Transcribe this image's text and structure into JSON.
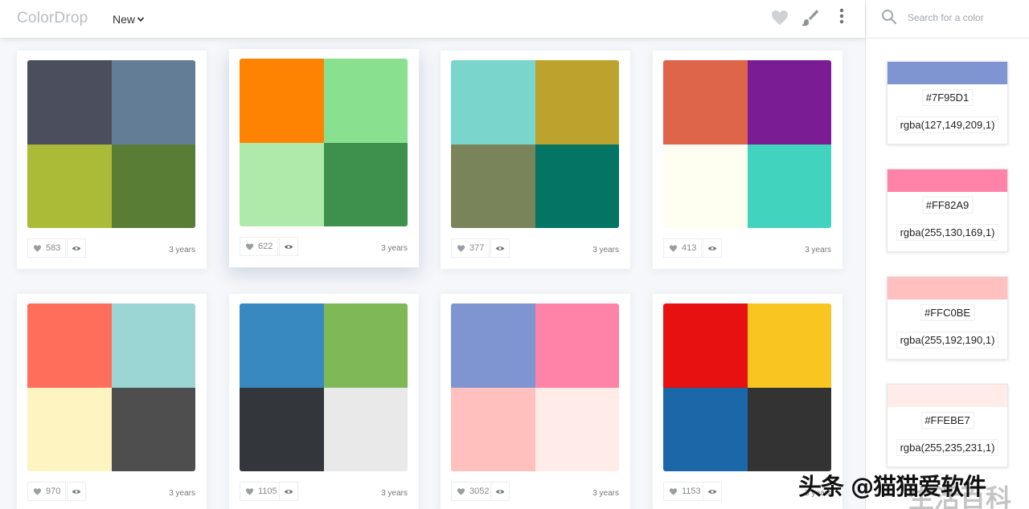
{
  "header": {
    "logo": "ColorDrop",
    "menu_new": "New"
  },
  "search": {
    "placeholder": "Search for a color"
  },
  "palettes": [
    {
      "colors": [
        "#4b4e5c",
        "#647d96",
        "#abbb37",
        "#5a7d35"
      ],
      "likes": "583",
      "age": "3 years"
    },
    {
      "colors": [
        "#ff8303",
        "#89e08f",
        "#b0eaaa",
        "#3e914d"
      ],
      "likes": "622",
      "age": "3 years"
    },
    {
      "colors": [
        "#7ad5cc",
        "#bca32d",
        "#7a845a",
        "#047465"
      ],
      "likes": "377",
      "age": "3 years"
    },
    {
      "colors": [
        "#de644a",
        "#7a1d94",
        "#fefef1",
        "#42d3bf"
      ],
      "likes": "413",
      "age": "3 years"
    },
    {
      "colors": [
        "#ff6e5a",
        "#9bd6d4",
        "#fef4c2",
        "#4e4e4f"
      ],
      "likes": "970",
      "age": "3 years"
    },
    {
      "colors": [
        "#3789c0",
        "#7fb957",
        "#33363b",
        "#e9e9e9"
      ],
      "likes": "1105",
      "age": "3 years"
    },
    {
      "colors": [
        "#7f95d1",
        "#ff82a9",
        "#ffc0be",
        "#ffebe7"
      ],
      "likes": "3052",
      "age": "3 years"
    },
    {
      "colors": [
        "#e71111",
        "#f9c621",
        "#1c67a7",
        "#333333"
      ],
      "likes": "1153",
      "age": "3 years"
    }
  ],
  "selected_swatches": [
    {
      "hex": "#7F95D1",
      "rgba": "rgba(127,149,209,1)",
      "color": "#7f95d1"
    },
    {
      "hex": "#FF82A9",
      "rgba": "rgba(255,130,169,1)",
      "color": "#ff82a9"
    },
    {
      "hex": "#FFC0BE",
      "rgba": "rgba(255,192,190,1)",
      "color": "#ffc0be"
    },
    {
      "hex": "#FFEBE7",
      "rgba": "rgba(255,235,231,1)",
      "color": "#ffebe7"
    }
  ],
  "watermark": {
    "main": "头条 @猫猫爱软件",
    "sub": "生活百科"
  }
}
